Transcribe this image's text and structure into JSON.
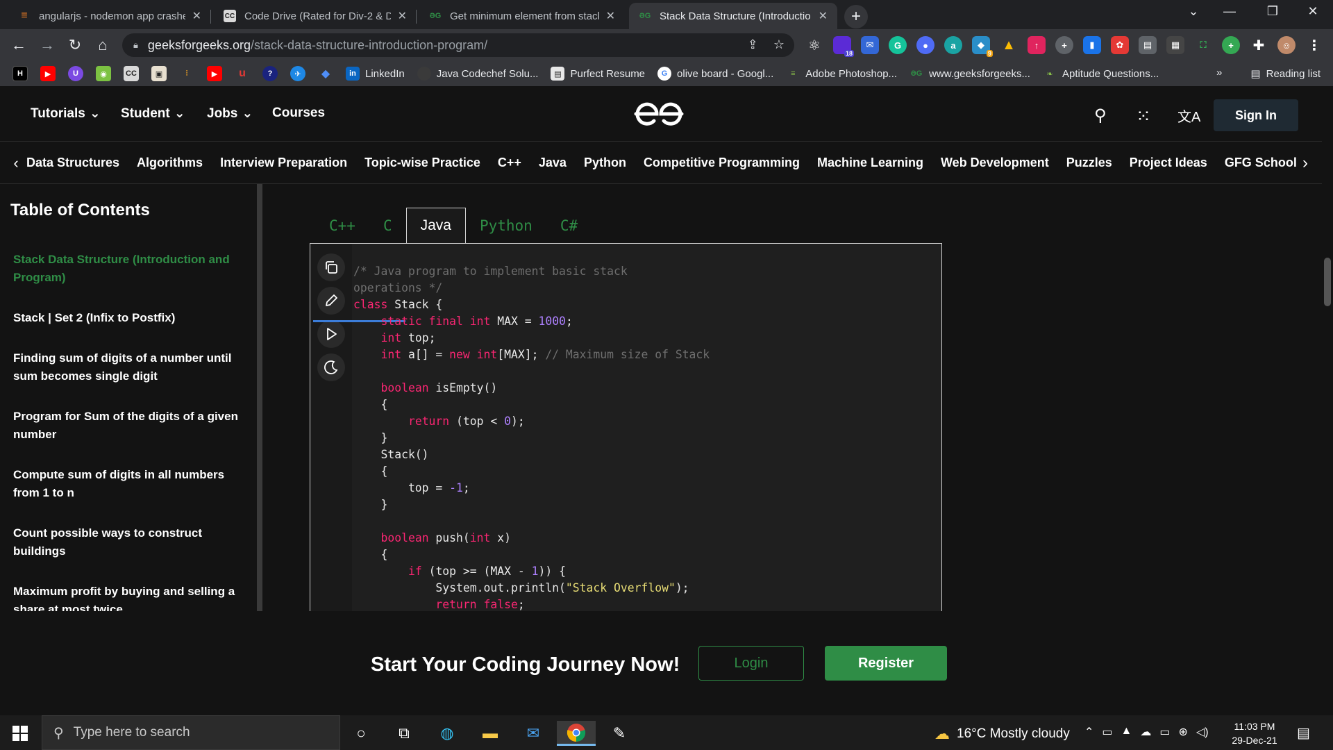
{
  "browser": {
    "tabs": [
      {
        "title": "angularjs - nodemon app crashe",
        "favicon": "stackoverflow-icon",
        "active": false
      },
      {
        "title": "Code Drive (Rated for Div-2 & Di",
        "favicon": "codechef-icon",
        "active": false
      },
      {
        "title": "Get minimum element from stack",
        "favicon": "gfg-icon",
        "active": false
      },
      {
        "title": "Stack Data Structure (Introductio",
        "favicon": "gfg-icon",
        "active": true
      }
    ],
    "url_host": "geeksforgeeks.org",
    "url_path": "/stack-data-structure-introduction-program/",
    "extension_badges": {
      "ext_count": "18",
      "ext_badge": "9"
    },
    "bookmarks": [
      {
        "label": "LinkedIn"
      },
      {
        "label": "Java Codechef Solu..."
      },
      {
        "label": "Purfect Resume"
      },
      {
        "label": "olive board - Googl..."
      },
      {
        "label": "Adobe Photoshop..."
      },
      {
        "label": "www.geeksforgeeks..."
      },
      {
        "label": "Aptitude Questions..."
      }
    ],
    "bookmarks_overflow": "»",
    "reading_list": "Reading list"
  },
  "site": {
    "header_nav": {
      "tutorials": "Tutorials",
      "student": "Student",
      "jobs": "Jobs",
      "courses": "Courses"
    },
    "sign_in": "Sign In",
    "subnav": [
      "Data Structures",
      "Algorithms",
      "Interview Preparation",
      "Topic-wise Practice",
      "C++",
      "Java",
      "Python",
      "Competitive Programming",
      "Machine Learning",
      "Web Development",
      "Puzzles",
      "Project Ideas",
      "GFG School"
    ],
    "toc": {
      "title": "Table of Contents",
      "items": [
        "Stack Data Structure (Introduction and Program)",
        "Stack | Set 2 (Infix to Postfix)",
        "Finding sum of digits of a number until sum becomes single digit",
        "Program for Sum of the digits of a given number",
        "Compute sum of digits in all numbers from 1 to n",
        "Count possible ways to construct buildings",
        "Maximum profit by buying and selling a share at most twice"
      ]
    },
    "code_tabs": [
      "C++",
      "C",
      "Java",
      "Python",
      "C#"
    ],
    "active_code_tab": "Java",
    "cta": {
      "heading": "Start Your Coding Journey Now!",
      "login": "Login",
      "register": "Register"
    }
  },
  "taskbar": {
    "search_placeholder": "Type here to search",
    "weather": "16°C  Mostly cloudy",
    "time": "11:03 PM",
    "date": "29-Dec-21"
  },
  "colors": {
    "gfg_green": "#2f8d46",
    "keyword": "#f92672",
    "number": "#ae81ff",
    "string": "#e6db74",
    "comment": "#6e6e6e"
  }
}
